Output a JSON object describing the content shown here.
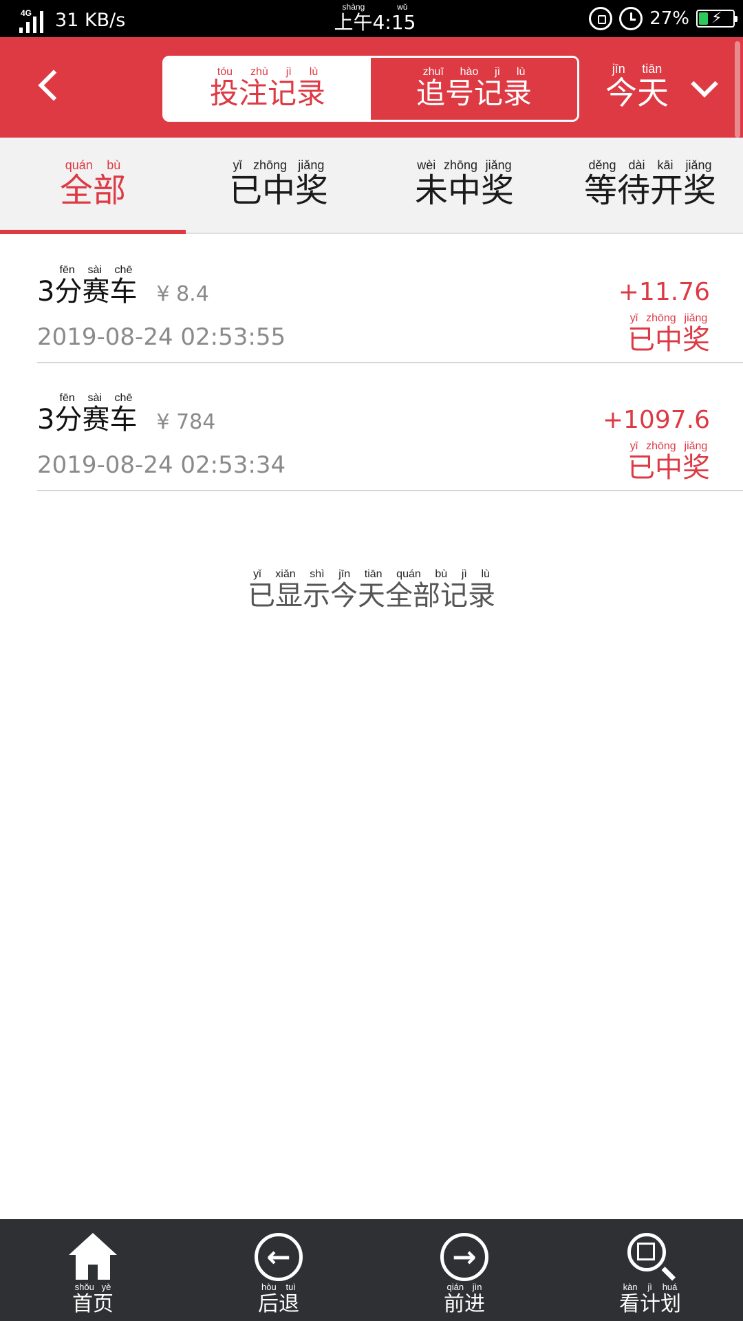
{
  "status_bar": {
    "network": "4G",
    "speed": "31 KB/s",
    "time": "上午4:15",
    "time_pinyin": "shàng wǔ",
    "battery": "27%",
    "battery_level": 0.27
  },
  "header": {
    "segments": [
      {
        "label": "投注记录",
        "pinyin": "tóu zhù jì lù"
      },
      {
        "label": "追号记录",
        "pinyin": "zhuī hào jì lù"
      }
    ],
    "date_filter": {
      "label": "今天",
      "pinyin": "jīn tiān"
    }
  },
  "filter_tabs": [
    {
      "label": "全部",
      "pinyin": "quán bù"
    },
    {
      "label": "已中奖",
      "pinyin": "yǐ zhōng jiǎng"
    },
    {
      "label": "未中奖",
      "pinyin": "wèi zhōng jiǎng"
    },
    {
      "label": "等待开奖",
      "pinyin": "děng dài kāi jiǎng"
    }
  ],
  "records": [
    {
      "game_prefix": "3",
      "game": "分赛车",
      "game_pinyin": "fēn sài chē",
      "amount": "¥ 8.4",
      "datetime": "2019-08-24 02:53:55",
      "profit": "+11.76",
      "status": "已中奖",
      "status_pinyin": "yǐ zhōng jiǎng"
    },
    {
      "game_prefix": "3",
      "game": "分赛车",
      "game_pinyin": "fēn sài chē",
      "amount": "¥ 784",
      "datetime": "2019-08-24 02:53:34",
      "profit": "+1097.6",
      "status": "已中奖",
      "status_pinyin": "yǐ zhōng jiǎng"
    }
  ],
  "footer_note": {
    "text": "已显示今天全部记录",
    "pinyin": "yǐ xiǎn shì jīn tiān quán bù jì lù"
  },
  "bottom_nav": [
    {
      "label": "首页",
      "pinyin": "shǒu yè",
      "icon": "home-icon"
    },
    {
      "label": "后退",
      "pinyin": "hòu tuì",
      "icon": "arrow-left-circle-icon"
    },
    {
      "label": "前进",
      "pinyin": "qián jìn",
      "icon": "arrow-right-circle-icon"
    },
    {
      "label": "看计划",
      "pinyin": "kàn jì huá",
      "icon": "search-plan-icon"
    }
  ],
  "colors": {
    "brand_red": "#dd3a44",
    "nav_dark": "#2e3033",
    "battery_green": "#2ec95b"
  }
}
